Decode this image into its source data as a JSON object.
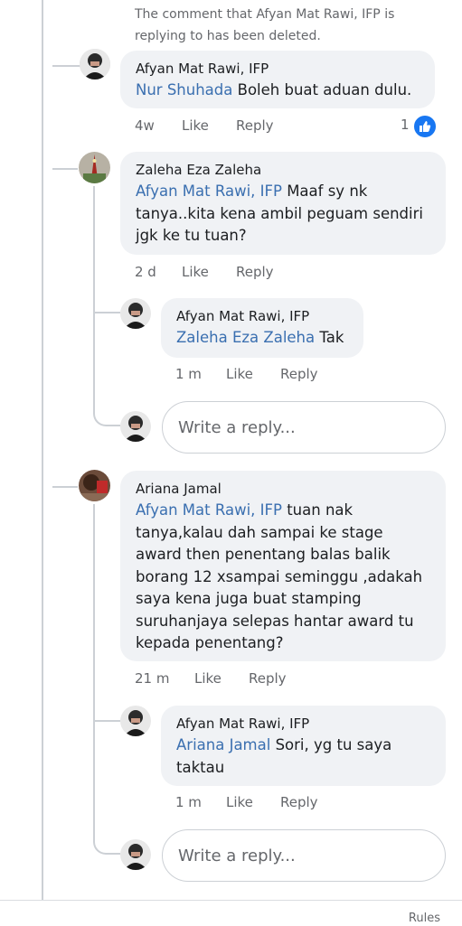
{
  "deleted_notice": "The comment that Afyan Mat Rawi, IFP is replying to has been deleted.",
  "comments": [
    {
      "author": "Afyan Mat Rawi, IFP",
      "mention": "Nur Shuhada",
      "body": " Boleh buat aduan dulu.",
      "time": "4w",
      "like": "Like",
      "reply": "Reply",
      "reaction_count": "1"
    },
    {
      "author": "Zaleha Eza Zaleha",
      "mention": "Afyan Mat Rawi, IFP",
      "body_lines": [
        " Maaf sy nk",
        "tanya..kita kena ambil peguam sendiri",
        "jgk ke tu tuan?"
      ],
      "time": "2 d",
      "like": "Like",
      "reply": "Reply",
      "replies": [
        {
          "author": "Afyan Mat Rawi, IFP",
          "mention": "Zaleha Eza Zaleha",
          "body": " Tak",
          "time": "1 m",
          "like": "Like",
          "reply": "Reply"
        }
      ],
      "reply_placeholder": "Write a reply..."
    },
    {
      "author": "Ariana Jamal",
      "mention": "Afyan Mat Rawi, IFP",
      "body_lines": [
        " tuan nak",
        "tanya,kalau dah sampai ke stage",
        "award then penentang balas balik",
        "borang 12 xsampai seminggu ,adakah",
        "saya kena juga buat stamping",
        "suruhanjaya selepas hantar award tu",
        "kepada penentang?"
      ],
      "time": "21 m",
      "like": "Like",
      "reply": "Reply",
      "replies": [
        {
          "author": "Afyan Mat Rawi, IFP",
          "mention": "Ariana Jamal",
          "body_lines": [
            " Sori, yg tu saya",
            "taktau"
          ],
          "time": "1 m",
          "like": "Like",
          "reply": "Reply"
        }
      ],
      "reply_placeholder": "Write a reply..."
    }
  ],
  "footer": {
    "rules": "Rules"
  },
  "colors": {
    "mention": "#3a6fb0",
    "bubble": "#f0f2f5",
    "like_badge": "#1877f2",
    "thread_line": "#ccd0d5"
  }
}
